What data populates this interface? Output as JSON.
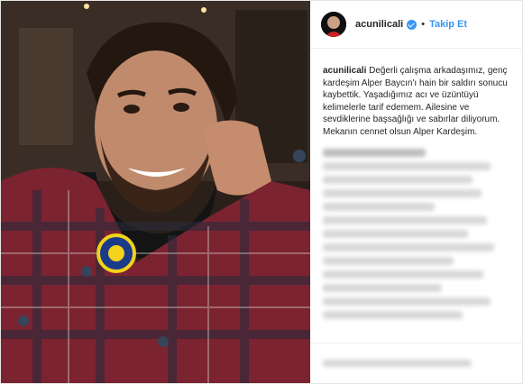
{
  "post": {
    "username": "acunilicali",
    "follow_label": "Takip Et",
    "separator": "•",
    "caption_user": "acunilicali",
    "caption_text": "Değerli çalışma arkadaşımız, genç kardeşim Alper Baycın'ı hain bir saldırı sonucu kaybettik. Yaşadığımız acı ve üzüntüyü kelimelerle tarif edemem. Ailesine ve sevdiklerine başsağlığı ve sabırlar diliyorum. Mekanın cennet olsun Alper Kardeşim."
  },
  "colors": {
    "accent": "#3897f0",
    "text": "#262626",
    "border": "#efefef"
  },
  "icons": {
    "verified": "verified-badge-icon"
  }
}
